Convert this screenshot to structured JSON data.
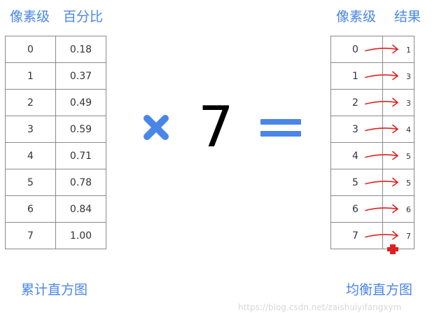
{
  "left": {
    "header_pixel": "像素级",
    "header_value": "百分比",
    "rows": [
      {
        "pixel": "0",
        "value": "0.18"
      },
      {
        "pixel": "1",
        "value": "0.37"
      },
      {
        "pixel": "2",
        "value": "0.49"
      },
      {
        "pixel": "3",
        "value": "0.59"
      },
      {
        "pixel": "4",
        "value": "0.71"
      },
      {
        "pixel": "5",
        "value": "0.78"
      },
      {
        "pixel": "6",
        "value": "0.84"
      },
      {
        "pixel": "7",
        "value": "1.00"
      }
    ],
    "caption": "累计直方图"
  },
  "operator": {
    "multiply_color": "#4a86e8",
    "factor": "7",
    "equals_color": "#4a86e8"
  },
  "right": {
    "header_pixel": "像素级",
    "header_result": "结果",
    "rows": [
      {
        "pixel": "0",
        "result": "1"
      },
      {
        "pixel": "1",
        "result": "3"
      },
      {
        "pixel": "2",
        "result": "3"
      },
      {
        "pixel": "3",
        "result": "4"
      },
      {
        "pixel": "4",
        "result": "5"
      },
      {
        "pixel": "5",
        "result": "5"
      },
      {
        "pixel": "6",
        "result": "6"
      },
      {
        "pixel": "7",
        "result": "7"
      }
    ],
    "caption": "均衡直方图",
    "arrow_color": "#e02020"
  },
  "watermark": "https://blog.csdn.net/zaishuiyifangxym"
}
